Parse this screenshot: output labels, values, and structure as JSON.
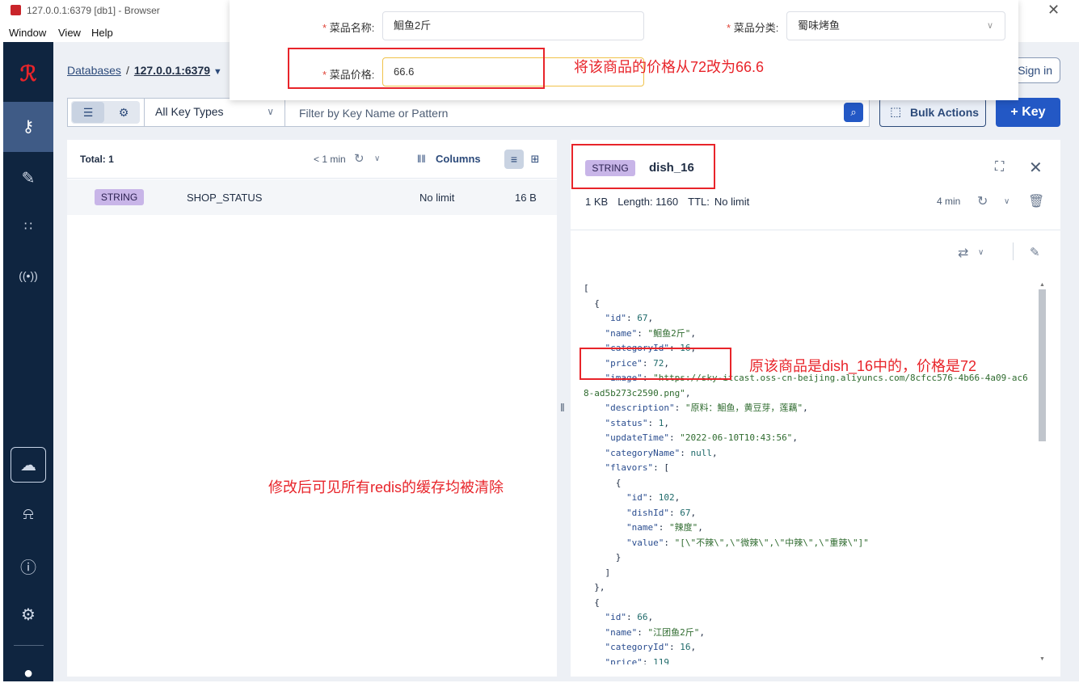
{
  "window": {
    "title": "127.0.0.1:6379 [db1] - Browser",
    "close_glyph": "✕"
  },
  "menu": [
    "Window",
    "View",
    "Help"
  ],
  "breadcrumb": {
    "databases": "Databases",
    "separator": "/",
    "host": "127.0.0.1:6379"
  },
  "header": {
    "signin_label": "Sign in"
  },
  "toolbar": {
    "key_type": "All Key Types",
    "filter_placeholder": "Filter by Key Name or Pattern",
    "bulk_actions": "Bulk Actions",
    "add_key": "+ Key"
  },
  "key_list": {
    "total": "Total: 1",
    "refresh_time": "< 1 min",
    "columns_label": "Columns",
    "rows": [
      {
        "type": "STRING",
        "name": "SHOP_STATUS",
        "ttl": "No limit",
        "size": "16 B"
      }
    ]
  },
  "detail": {
    "type": "STRING",
    "key": "dish_16",
    "size": "1 KB",
    "length": "Length: 1160",
    "ttl_label": "TTL:",
    "ttl_value": "No limit",
    "refresh_time": "4 min",
    "json_text": [
      "[",
      "  {",
      "    \"id\": 67,",
      "    \"name\": \"鮰鱼2斤\",",
      "    \"categoryId\": 16,",
      "    \"price\": 72,",
      "    \"image\": \"https://sky-itcast.oss-cn-beijing.aliyuncs.com/8cfcc576-4b66-4a09-ac68-ad5b273c2590.png\",",
      "    \"description\": \"原料：鮰鱼，黄豆芽，莲藕\",",
      "    \"status\": 1,",
      "    \"updateTime\": \"2022-06-10T10:43:56\",",
      "    \"categoryName\": null,",
      "    \"flavors\": [",
      "      {",
      "        \"id\": 102,",
      "        \"dishId\": 67,",
      "        \"name\": \"辣度\",",
      "        \"value\": \"[\\\"不辣\\\",\\\"微辣\\\",\\\"中辣\\\",\\\"重辣\\\"]\"",
      "      }",
      "    ]",
      "  },",
      "  {",
      "    \"id\": 66,",
      "    \"name\": \"江团鱼2斤\",",
      "    \"categoryId\": 16,",
      "    \"price\": 119"
    ]
  },
  "form": {
    "required_mark": "*",
    "name_label": "菜品名称:",
    "name_value": "鮰鱼2斤",
    "category_label": "菜品分类:",
    "category_value": "蜀味烤鱼",
    "price_label": "菜品价格:",
    "price_value": "66.6"
  },
  "annotations": {
    "price_change": "将该商品的价格从72改为66.6",
    "original": "原该商品是dish_16中的，价格是72",
    "cleared": "修改后可见所有redis的缓存均被清除"
  },
  "colors": {
    "sidebar": "#0f2540",
    "accent": "#2358c5",
    "string_badge": "#c8b5e8",
    "annotation_red": "#e8242a"
  },
  "icons": {
    "sidebar": [
      "redis-logo-icon",
      "key-icon",
      "edit-icon",
      "analytics-icon",
      "pubsub-icon",
      "cloud-icon",
      "bell-icon",
      "help-icon",
      "settings-icon",
      "github-icon"
    ]
  }
}
